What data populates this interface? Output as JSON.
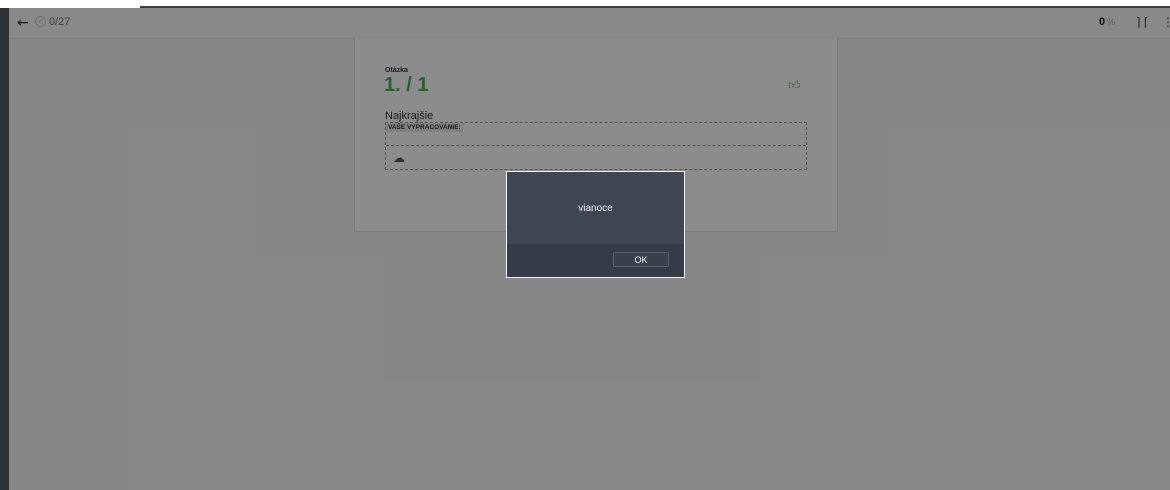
{
  "header": {
    "back_icon": "arrow-left-icon",
    "check_icon": "check-circle-icon",
    "progress": "0/27",
    "percent_value": "0",
    "percent_sign": "%",
    "fullscreen_icon": "fullscreen-icon",
    "menu_icon": "menu-icon"
  },
  "question": {
    "label": "Otázka",
    "number": "1. / 1",
    "thumb_icon": "thumbs-up-icon",
    "title": "Najkrajšie",
    "answer_label": "VAŠE VYPRACOVANIE:",
    "upload_icon": "cloud-upload-icon"
  },
  "dialog": {
    "message": "vianoce",
    "ok_label": "OK"
  },
  "colors": {
    "accent_green": "#4caf50",
    "dialog_bg": "#3f4553",
    "overlay": "rgba(0,0,0,0.45)"
  }
}
